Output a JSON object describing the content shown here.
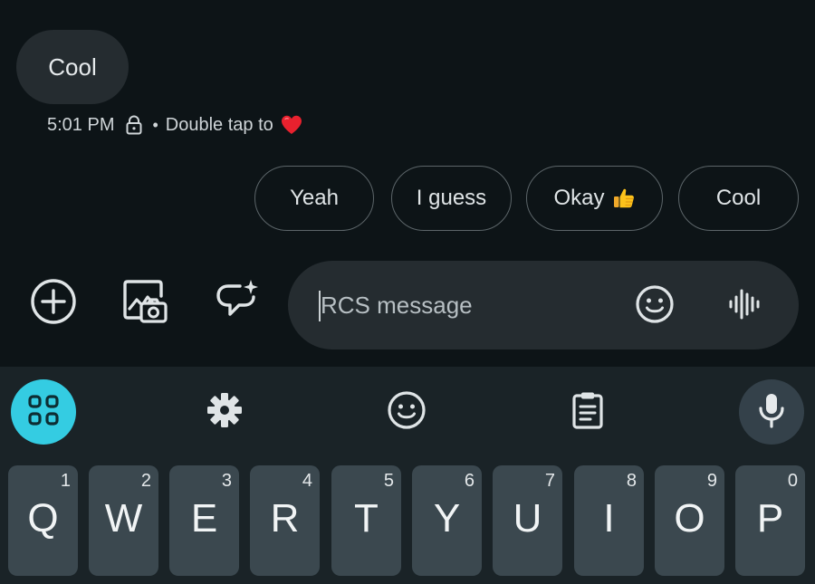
{
  "conversation": {
    "incoming_message": "Cool",
    "timestamp": "5:01 PM",
    "separator": "•",
    "hint": "Double tap to",
    "heart_icon": "red-heart-icon",
    "lock_icon": "lock-icon"
  },
  "smart_replies": [
    {
      "label": "Yeah"
    },
    {
      "label": "I guess"
    },
    {
      "label": "Okay",
      "emoji": "thumbs-up-icon"
    },
    {
      "label": "Cool"
    }
  ],
  "compose": {
    "placeholder": "RCS message",
    "actions": [
      "add-icon",
      "gallery-camera-icon",
      "sparkle-chat-icon"
    ],
    "emoji_icon": "emoji-icon",
    "voice_icon": "voice-waveform-icon"
  },
  "keyboard": {
    "toolbar": [
      "apps-grid-icon",
      "gear-icon",
      "emoji-icon",
      "clipboard-icon",
      "microphone-icon"
    ],
    "accent_color": "#34cce2",
    "keys": [
      {
        "letter": "Q",
        "num": "1"
      },
      {
        "letter": "W",
        "num": "2"
      },
      {
        "letter": "E",
        "num": "3"
      },
      {
        "letter": "R",
        "num": "4"
      },
      {
        "letter": "T",
        "num": "5"
      },
      {
        "letter": "Y",
        "num": "6"
      },
      {
        "letter": "U",
        "num": "7"
      },
      {
        "letter": "I",
        "num": "8"
      },
      {
        "letter": "O",
        "num": "9"
      },
      {
        "letter": "P",
        "num": "0"
      }
    ]
  }
}
